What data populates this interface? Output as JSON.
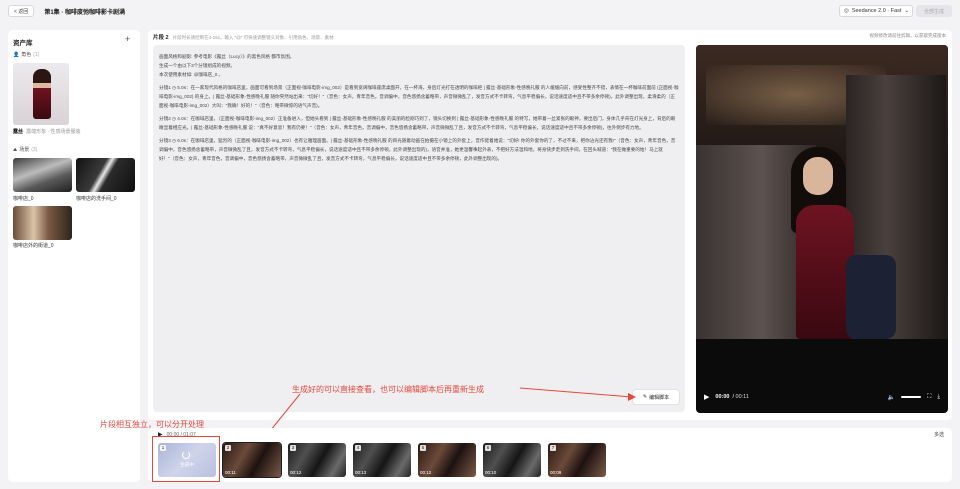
{
  "topbar": {
    "back_label": "< 返回",
    "episode_title": "第1集 · 咖啡废弛咖啡影卡剧满",
    "model_label": "Seedance 2.0 · Fast",
    "generate_label": "全部生成"
  },
  "assets": {
    "title": "资产库",
    "add_icon": "plus-icon",
    "roles_label": "角色",
    "roles_count": "(1)",
    "role_name": "露丝",
    "role_desc": "- 露端形象 · 性感场景服装",
    "scenes_label": "场景",
    "scenes_count": "(3)",
    "scenes": [
      {
        "name": "咖啡店_0"
      },
      {
        "name": "咖啡店的洗手间_0"
      },
      {
        "name": "咖啡店外的街道_0"
      }
    ]
  },
  "segment": {
    "title": "片段 2",
    "subtitle": "片段时长请控制在4-15s，输入 \"@\" 可快速调整镜头对象、引用角色、场景、素材",
    "edit_hint": "视频修改请前往剪辑，以获取完成版本",
    "script_lines": [
      "画面风格和剧影: 参考电影《露丝（Lucy）》的黑色风格 都市氛围。",
      "生成一个由以下3个分镜组成的视频。",
      "本次使用素材如: @咖啡店_0 。",
      "分镜1 ◷ 5.0s：在一家现代风格的咖啡店里，画面可看到场景（正面视-咖啡电影-img_002）是看到宽阔咖啡座席桌面开，在一杯海，身后灯光打在透明的咖啡柜 | 露丝-基础形象-性感晚礼服 的人缓缓向前，感受性整齐不错，表情在一杯咖啡前面前 (正面视-咖啡电影-img_002) 的身上。| 露丝-基础形象-性感晚礼服 随你突然站出来：\"切好！\"（音色：女声，青年音色，音调偏中，音色悠扬含蓄略带，声音微微乱了，发音方式不卡转弯，气息平稳偏长，说话速度适中且不带多余停顿)，此外调整出现，柔滑柔的（正面视-咖啡电影-img_002）大叫：\"我确！好的！\"（音色：略带微惊的语气声音)。",
      "分镜2 ◷ 4.0s：在咖啡店里，（正面视-咖啡电影-img_002）正准备进入，但她头看到 | 露丝-基础形象-性感晚礼服 的美丽的脸刚巧到了，镜头切换到 | 露丝-基础形象-性感晚礼服 的特写，她带着一丝紧张的眼神，要出后门，身体几乎背在灯光身上，背后的眼睛显着相应光。| 露丝-基础形象-性感晚礼服 说：\"真不好意思！我有仍要！\"（音色：女声，青年音色，音调偏中，音色悠扬含蓄略带，声音微微乱了且，发音方式不卡转弯，气息平稳偏长，说话速度适中且不带多余停顿)，往外侧步有力地。",
      "分镜3 ◷ 6.0s：在咖啡店里，猛烈的（正面视-咖啡电影-img_002）也有让雅理画面。| 露丝-基础形象-性感晚礼服 的目光随着动画在拍摄在小镜上的外套上，音作佬着她说：\"切好! 你的外套你的了，不过不来，把你沾光还有我!\"（音色：女声，青年音色，音调偏中，音色悠扬含蓄略带，声音微微乱了且，发音方式不卡转弯，气息平稳偏长，说话速度适中且不带多余停顿，此外调整出现的)，语音并准，她更温馨事起外表，不把好方法温和地，将身快步走到洗手间，在回头喊道：\"我在做重要的始！马上就好！\"（音色：女声，青年音色，音调偏中，音色悠扬含蓄略带，声音微微乱了且，发音方式不卡转弯，气息平稳偏长，说话速度适中且不带多余停顿，此外调整出现的)。"
    ],
    "edit_script_label": "编辑脚本"
  },
  "player": {
    "current_time": "00:00",
    "duration": "00:11"
  },
  "annotations": {
    "top": "生成好的可以直接查看，也可以编辑脚本后再重新生成",
    "left": "片段相互独立，可以分开处理"
  },
  "timeline": {
    "time_readout": "00:00 / 01:07",
    "multi_select_label": "多选",
    "clips": [
      {
        "index": "1",
        "status": "生成中",
        "duration": ""
      },
      {
        "index": "2",
        "status": "",
        "duration": "00:11"
      },
      {
        "index": "3",
        "status": "",
        "duration": "00:12"
      },
      {
        "index": "4",
        "status": "",
        "duration": "00:13"
      },
      {
        "index": "5",
        "status": "",
        "duration": "00:12"
      },
      {
        "index": "6",
        "status": "",
        "duration": "00:10"
      },
      {
        "index": "7",
        "status": "",
        "duration": "00:09"
      }
    ]
  },
  "colors": {
    "annotation_red": "#e8463c",
    "panel_bg": "#ffffff",
    "page_bg": "#f3f3f5"
  }
}
